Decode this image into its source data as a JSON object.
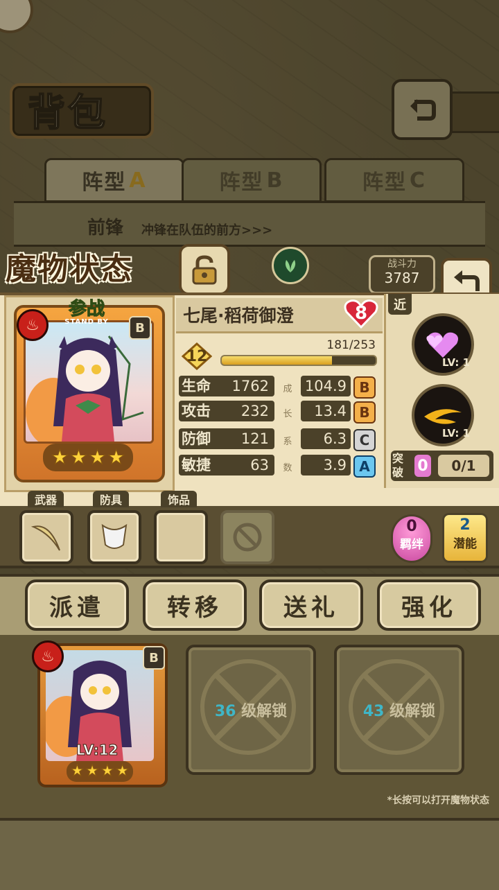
{
  "bag": {
    "title": "背包"
  },
  "tabs": [
    {
      "label": "阵型",
      "suffix": "A",
      "active": true
    },
    {
      "label": "阵型",
      "suffix": "B",
      "active": false
    },
    {
      "label": "阵型",
      "suffix": "C",
      "active": false
    }
  ],
  "formation": {
    "position": "前锋",
    "description": "冲锋在队伍的前方>>>"
  },
  "status": {
    "title": "魔物状态",
    "power_label": "战斗力",
    "power_value": "3787"
  },
  "card": {
    "standby_big": "参战",
    "standby_small": "STAND BY",
    "rank": "B",
    "stars": 4
  },
  "monster": {
    "name": "七尾·稻荷御澄",
    "heart_level": "8",
    "level": "12",
    "exp_text": "181/253",
    "exp_fraction": 0.715
  },
  "stats": [
    {
      "name": "生命",
      "value": "1762",
      "growth": "104.9",
      "grade": "B"
    },
    {
      "name": "攻击",
      "value": "232",
      "growth": "13.4",
      "grade": "B"
    },
    {
      "name": "防御",
      "value": "121",
      "growth": "6.3",
      "grade": "C"
    },
    {
      "name": "敏捷",
      "value": "63",
      "growth": "3.9",
      "grade": "A"
    }
  ],
  "growth_vertical": [
    "成",
    "长",
    "系",
    "数"
  ],
  "skills": {
    "range_tag": "近",
    "items": [
      {
        "icon": "hearts-skill-icon",
        "level": "LV: 1"
      },
      {
        "icon": "fire-slash-skill-icon",
        "level": "LV: 1"
      }
    ],
    "breakthrough_label": "突破",
    "breakthrough_value": "0",
    "breakthrough_progress": "0/1"
  },
  "equipment": {
    "weapon_label": "武器",
    "armor_label": "防具",
    "accessory_label": "饰品"
  },
  "bond": {
    "value": "0",
    "label": "羁绊"
  },
  "potential": {
    "value": "2",
    "label": "潜能"
  },
  "actions": [
    "派遣",
    "转移",
    "送礼",
    "强化"
  ],
  "team": {
    "slot1_level": "LV:12",
    "slot1_rank": "B",
    "slot2": {
      "num": "36",
      "text": "级解锁"
    },
    "slot3": {
      "num": "43",
      "text": "级解锁"
    },
    "hint": "*长按可以打开魔物状态"
  },
  "colors": {
    "fire": "#c8201a",
    "gold": "#f2d14a",
    "panel": "#efe2bf"
  }
}
